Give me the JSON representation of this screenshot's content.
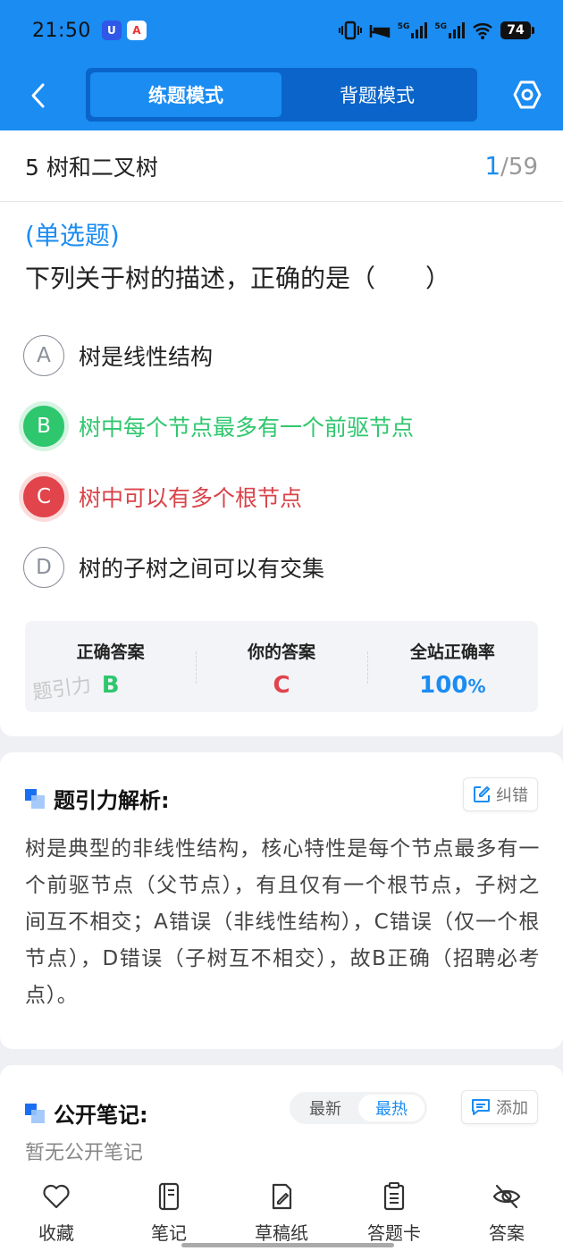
{
  "status_bar": {
    "time": "21:50",
    "battery": "74",
    "network_label_1": "5G",
    "network_label_2": "5G",
    "app_icon_u": "U",
    "app_icon_a": "A"
  },
  "header": {
    "tabs": [
      {
        "label": "练题模式",
        "active": true
      },
      {
        "label": "背题模式",
        "active": false
      }
    ]
  },
  "question": {
    "chapter": "5 树和二叉树",
    "current": "1",
    "separator": "/",
    "total": "59",
    "type_tag": "(单选题)",
    "text": "下列关于树的描述，正确的是（　　）",
    "options": [
      {
        "letter": "A",
        "text": "树是线性结构",
        "state": "normal"
      },
      {
        "letter": "B",
        "text": "树中每个节点最多有一个前驱节点",
        "state": "correct"
      },
      {
        "letter": "C",
        "text": "树中可以有多个根节点",
        "state": "wrong"
      },
      {
        "letter": "D",
        "text": "树的子树之间可以有交集",
        "state": "normal"
      }
    ]
  },
  "result": {
    "correct_label": "正确答案",
    "correct_value": "B",
    "yours_label": "你的答案",
    "yours_value": "C",
    "rate_label": "全站正确率",
    "rate_value": "100",
    "rate_unit": "%",
    "watermark": "题引力"
  },
  "analysis": {
    "title": "题引力解析:",
    "report_label": "纠错",
    "body": "树是典型的非线性结构，核心特性是每个节点最多有一个前驱节点（父节点），有且仅有一个根节点，子树之间互不相交；A错误（非线性结构），C错误（仅一个根节点），D错误（子树互不相交），故B正确（招聘必考点）。"
  },
  "notes": {
    "title": "公开笔记:",
    "sort_options": [
      {
        "label": "最新",
        "active": false
      },
      {
        "label": "最热",
        "active": true
      }
    ],
    "add_label": "添加",
    "empty_text": "暂无公开笔记"
  },
  "bottom_bar": {
    "items": [
      {
        "label": "收藏",
        "icon": "heart-icon"
      },
      {
        "label": "笔记",
        "icon": "notebook-icon"
      },
      {
        "label": "草稿纸",
        "icon": "draft-pen-icon"
      },
      {
        "label": "答题卡",
        "icon": "answer-sheet-icon"
      },
      {
        "label": "答案",
        "icon": "eye-off-icon"
      }
    ]
  },
  "colors": {
    "brand_blue": "#1a8cf2",
    "correct_green": "#2fc76e",
    "wrong_red": "#e1444b"
  }
}
